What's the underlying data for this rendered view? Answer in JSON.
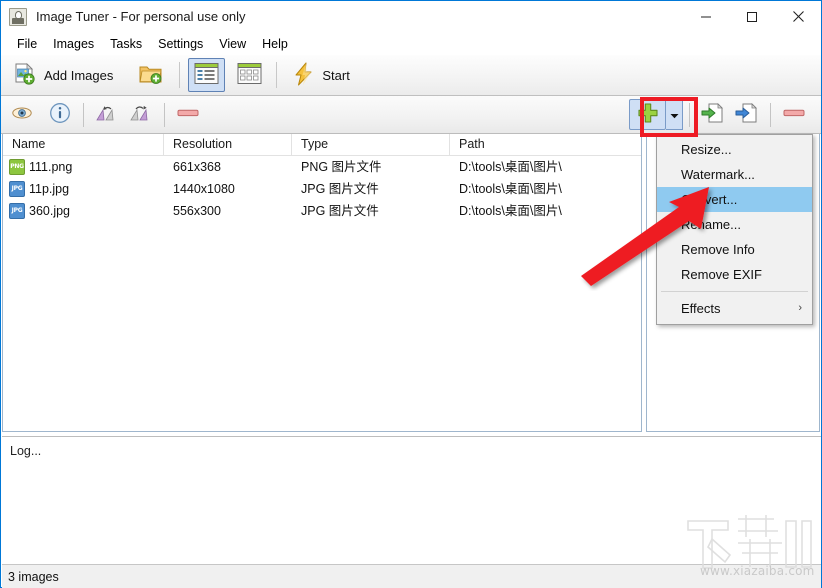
{
  "window": {
    "title": "Image Tuner - For personal use only",
    "icon": "app-icon",
    "controls": {
      "minimize": "minimize-icon",
      "maximize": "maximize-icon",
      "close": "close-icon"
    }
  },
  "menubar": {
    "items": [
      {
        "label": "File"
      },
      {
        "label": "Images"
      },
      {
        "label": "Tasks"
      },
      {
        "label": "Settings"
      },
      {
        "label": "View"
      },
      {
        "label": "Help"
      }
    ]
  },
  "toolbar": {
    "add_images_label": "Add Images",
    "add_images_icon": "add-image-icon",
    "add_folder_icon": "add-folder-icon",
    "list_view_icon": "list-view-icon",
    "thumb_view_icon": "thumbnail-view-icon",
    "start_label": "Start",
    "start_icon": "lightning-icon"
  },
  "toolbar2": {
    "preview_icon": "eye-icon",
    "info_icon": "info-icon",
    "rotate_left_icon": "rotate-left-icon",
    "rotate_right_icon": "rotate-right-icon",
    "remove_icon": "remove-icon",
    "add_task_icon": "plus-icon",
    "dropdown_icon": "chevron-down-icon",
    "move_down_icon": "task-down-icon",
    "move_up_icon": "task-up-icon",
    "delete_task_icon": "delete-task-icon"
  },
  "task_menu": {
    "items": [
      {
        "label": "Resize...",
        "selected": false,
        "submenu": false
      },
      {
        "label": "Watermark...",
        "selected": false,
        "submenu": false
      },
      {
        "label": "Convert...",
        "selected": true,
        "submenu": false
      },
      {
        "label": "Rename...",
        "selected": false,
        "submenu": false
      },
      {
        "label": "Remove Info",
        "selected": false,
        "submenu": false
      },
      {
        "label": "Remove EXIF",
        "selected": false,
        "submenu": false
      },
      {
        "label": "Effects",
        "selected": false,
        "submenu": true,
        "chevron": "›"
      }
    ],
    "highlight_color": "#8fcaf0"
  },
  "filelist": {
    "columns": [
      "Name",
      "Resolution",
      "Type",
      "Path"
    ],
    "rows": [
      {
        "icon": "png-file-icon",
        "type_short": "PNG",
        "name": "111.png",
        "resolution": "661x368",
        "type": "PNG 图片文件",
        "path": "D:\\tools\\桌面\\图片\\"
      },
      {
        "icon": "jpg-file-icon",
        "type_short": "JPG",
        "name": "11p.jpg",
        "resolution": "1440x1080",
        "type": "JPG 图片文件",
        "path": "D:\\tools\\桌面\\图片\\"
      },
      {
        "icon": "jpg-file-icon",
        "type_short": "JPG",
        "name": "360.jpg",
        "resolution": "556x300",
        "type": "JPG 图片文件",
        "path": "D:\\tools\\桌面\\图片\\"
      }
    ]
  },
  "log": {
    "text": "Log..."
  },
  "status": {
    "text": "3 images"
  },
  "watermark": {
    "url": "www.xiazaiba.com"
  },
  "colors": {
    "window_border": "#0078d7",
    "highlight": "#8fcaf0",
    "annotation_red": "#ee1b24",
    "toolbar_active": "#cfdff5"
  }
}
